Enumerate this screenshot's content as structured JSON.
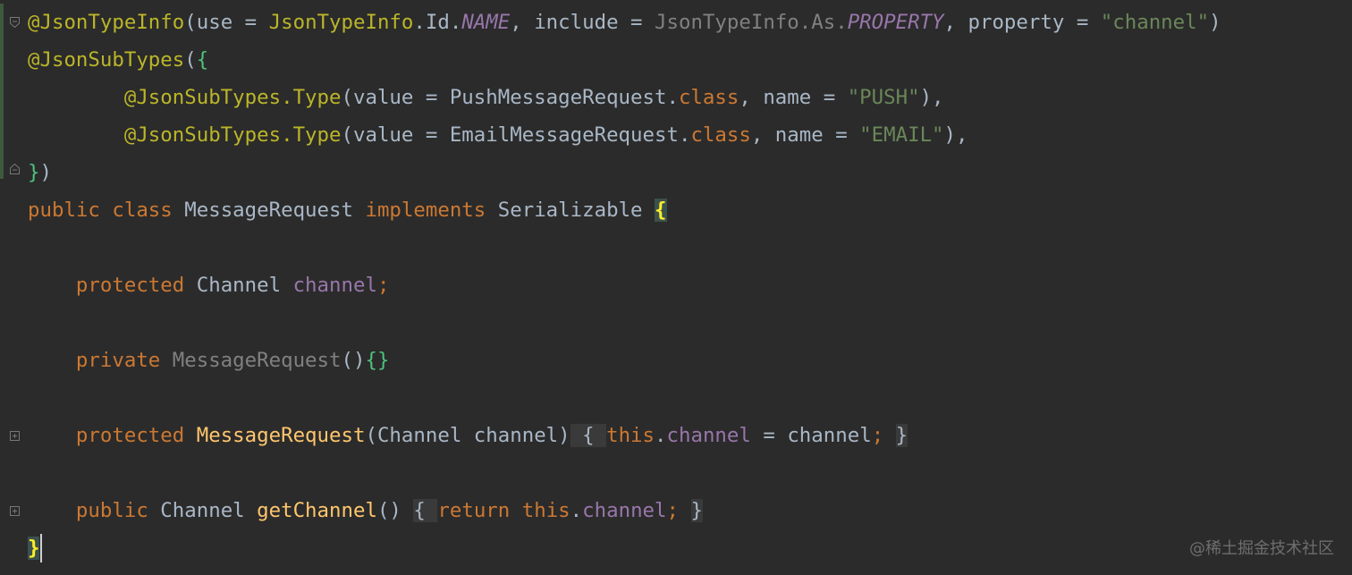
{
  "editor": {
    "lines": [
      [
        {
          "t": "@JsonTypeInfo",
          "c": "ann"
        },
        {
          "t": "(use = ",
          "c": "txt"
        },
        {
          "t": "JsonTypeInfo",
          "c": "ann"
        },
        {
          "t": ".Id.",
          "c": "txt"
        },
        {
          "t": "NAME",
          "c": "cst"
        },
        {
          "t": ", include = ",
          "c": "txt"
        },
        {
          "t": "JsonTypeInfo.As.",
          "c": "dim"
        },
        {
          "t": "PROPERTY",
          "c": "cst"
        },
        {
          "t": ", property = ",
          "c": "txt"
        },
        {
          "t": "\"channel\"",
          "c": "str"
        },
        {
          "t": ")",
          "c": "txt"
        }
      ],
      [
        {
          "t": "@JsonSubTypes",
          "c": "ann"
        },
        {
          "t": "(",
          "c": "txt"
        },
        {
          "t": "{",
          "c": "brc"
        }
      ],
      [
        {
          "t": "        ",
          "c": "txt"
        },
        {
          "t": "@JsonSubTypes.Type",
          "c": "ann"
        },
        {
          "t": "(value = PushMessageRequest.",
          "c": "txt"
        },
        {
          "t": "class",
          "c": "kw"
        },
        {
          "t": ", name = ",
          "c": "txt"
        },
        {
          "t": "\"PUSH\"",
          "c": "str"
        },
        {
          "t": "),",
          "c": "txt"
        }
      ],
      [
        {
          "t": "        ",
          "c": "txt"
        },
        {
          "t": "@JsonSubTypes.Type",
          "c": "ann"
        },
        {
          "t": "(value = EmailMessageRequest.",
          "c": "txt"
        },
        {
          "t": "class",
          "c": "kw"
        },
        {
          "t": ", name = ",
          "c": "txt"
        },
        {
          "t": "\"EMAIL\"",
          "c": "str"
        },
        {
          "t": "),",
          "c": "txt"
        }
      ],
      [
        {
          "t": "}",
          "c": "brc"
        },
        {
          "t": ")",
          "c": "txt"
        }
      ],
      [
        {
          "t": "public class ",
          "c": "kw"
        },
        {
          "t": "MessageRequest ",
          "c": "txt"
        },
        {
          "t": "implements ",
          "c": "kw"
        },
        {
          "t": "Serializable ",
          "c": "txt"
        },
        {
          "t": "{",
          "c": "brc-hl"
        }
      ],
      [],
      [
        {
          "t": "    ",
          "c": "txt"
        },
        {
          "t": "protected ",
          "c": "kw"
        },
        {
          "t": "Channel ",
          "c": "txt"
        },
        {
          "t": "channel",
          "c": "fld"
        },
        {
          "t": ";",
          "c": "kw"
        }
      ],
      [],
      [
        {
          "t": "    ",
          "c": "txt"
        },
        {
          "t": "private ",
          "c": "kw"
        },
        {
          "t": "MessageRequest",
          "c": "dim"
        },
        {
          "t": "()",
          "c": "txt"
        },
        {
          "t": "{}",
          "c": "brc"
        }
      ],
      [],
      [
        {
          "t": "    ",
          "c": "txt"
        },
        {
          "t": "protected ",
          "c": "kw"
        },
        {
          "t": "MessageRequest",
          "c": "fn"
        },
        {
          "t": "(Channel channel)",
          "c": "txt"
        },
        {
          "t": " { ",
          "c": "fold-box"
        },
        {
          "t": "this",
          "c": "kw"
        },
        {
          "t": ".",
          "c": "txt"
        },
        {
          "t": "channel",
          "c": "fld"
        },
        {
          "t": " = channel",
          "c": "txt"
        },
        {
          "t": ";",
          "c": "kw"
        },
        {
          "t": " ",
          "c": "txt"
        },
        {
          "t": "}",
          "c": "fold-box"
        }
      ],
      [],
      [
        {
          "t": "    ",
          "c": "txt"
        },
        {
          "t": "public ",
          "c": "kw"
        },
        {
          "t": "Channel ",
          "c": "txt"
        },
        {
          "t": "getChannel",
          "c": "fn"
        },
        {
          "t": "()",
          "c": "txt"
        },
        {
          "t": " ",
          "c": "txt"
        },
        {
          "t": "{ ",
          "c": "fold-box"
        },
        {
          "t": "return this",
          "c": "kw"
        },
        {
          "t": ".",
          "c": "txt"
        },
        {
          "t": "channel",
          "c": "fld"
        },
        {
          "t": ";",
          "c": "kw"
        },
        {
          "t": " ",
          "c": "txt"
        },
        {
          "t": "}",
          "c": "fold-box"
        }
      ],
      [
        {
          "t": "}",
          "c": "brc-hl"
        }
      ]
    ]
  },
  "watermark": "@稀土掘金技术社区"
}
